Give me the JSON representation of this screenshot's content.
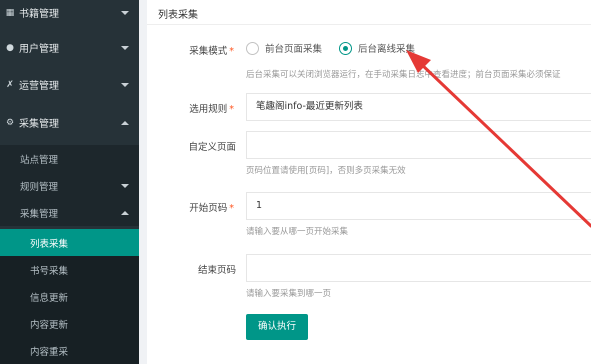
{
  "sidebar": {
    "top_items": [
      {
        "label": "书籍管理",
        "icon": "book-icon"
      },
      {
        "label": "用户管理",
        "icon": "user-icon"
      },
      {
        "label": "运营管理",
        "icon": "operations-icon"
      },
      {
        "label": "采集管理",
        "icon": "gear-icon"
      }
    ],
    "sub_items": [
      {
        "label": "站点管理"
      },
      {
        "label": "规则管理"
      },
      {
        "label": "采集管理"
      }
    ],
    "inner_items": [
      {
        "label": "列表采集"
      },
      {
        "label": "书号采集"
      },
      {
        "label": "信息更新"
      },
      {
        "label": "内容更新"
      },
      {
        "label": "内容重采"
      }
    ]
  },
  "main": {
    "card_title": "列表采集",
    "mode": {
      "label": "采集模式",
      "option_front": "前台页面采集",
      "option_back": "后台离线采集",
      "selected": "后台离线采集",
      "hint": "后台采集可以关闭浏览器运行，在手动采集日志中查看进度；前台页面采集必须保证"
    },
    "rule": {
      "label": "选用规则",
      "value": "笔趣阁info-最近更新列表"
    },
    "custom_page": {
      "label": "自定义页面",
      "value": "",
      "hint": "页码位置请使用[页码]，否则多页采集无效"
    },
    "start_page": {
      "label": "开始页码",
      "value": "1",
      "hint": "请输入要从哪一页开始采集"
    },
    "end_page": {
      "label": "结束页码",
      "value": "",
      "hint": "请输入要采集到哪一页"
    },
    "submit_label": "确认执行"
  },
  "colors": {
    "accent": "#009688",
    "sidebar_bg": "#263238",
    "annotation_arrow": "#e53935"
  }
}
